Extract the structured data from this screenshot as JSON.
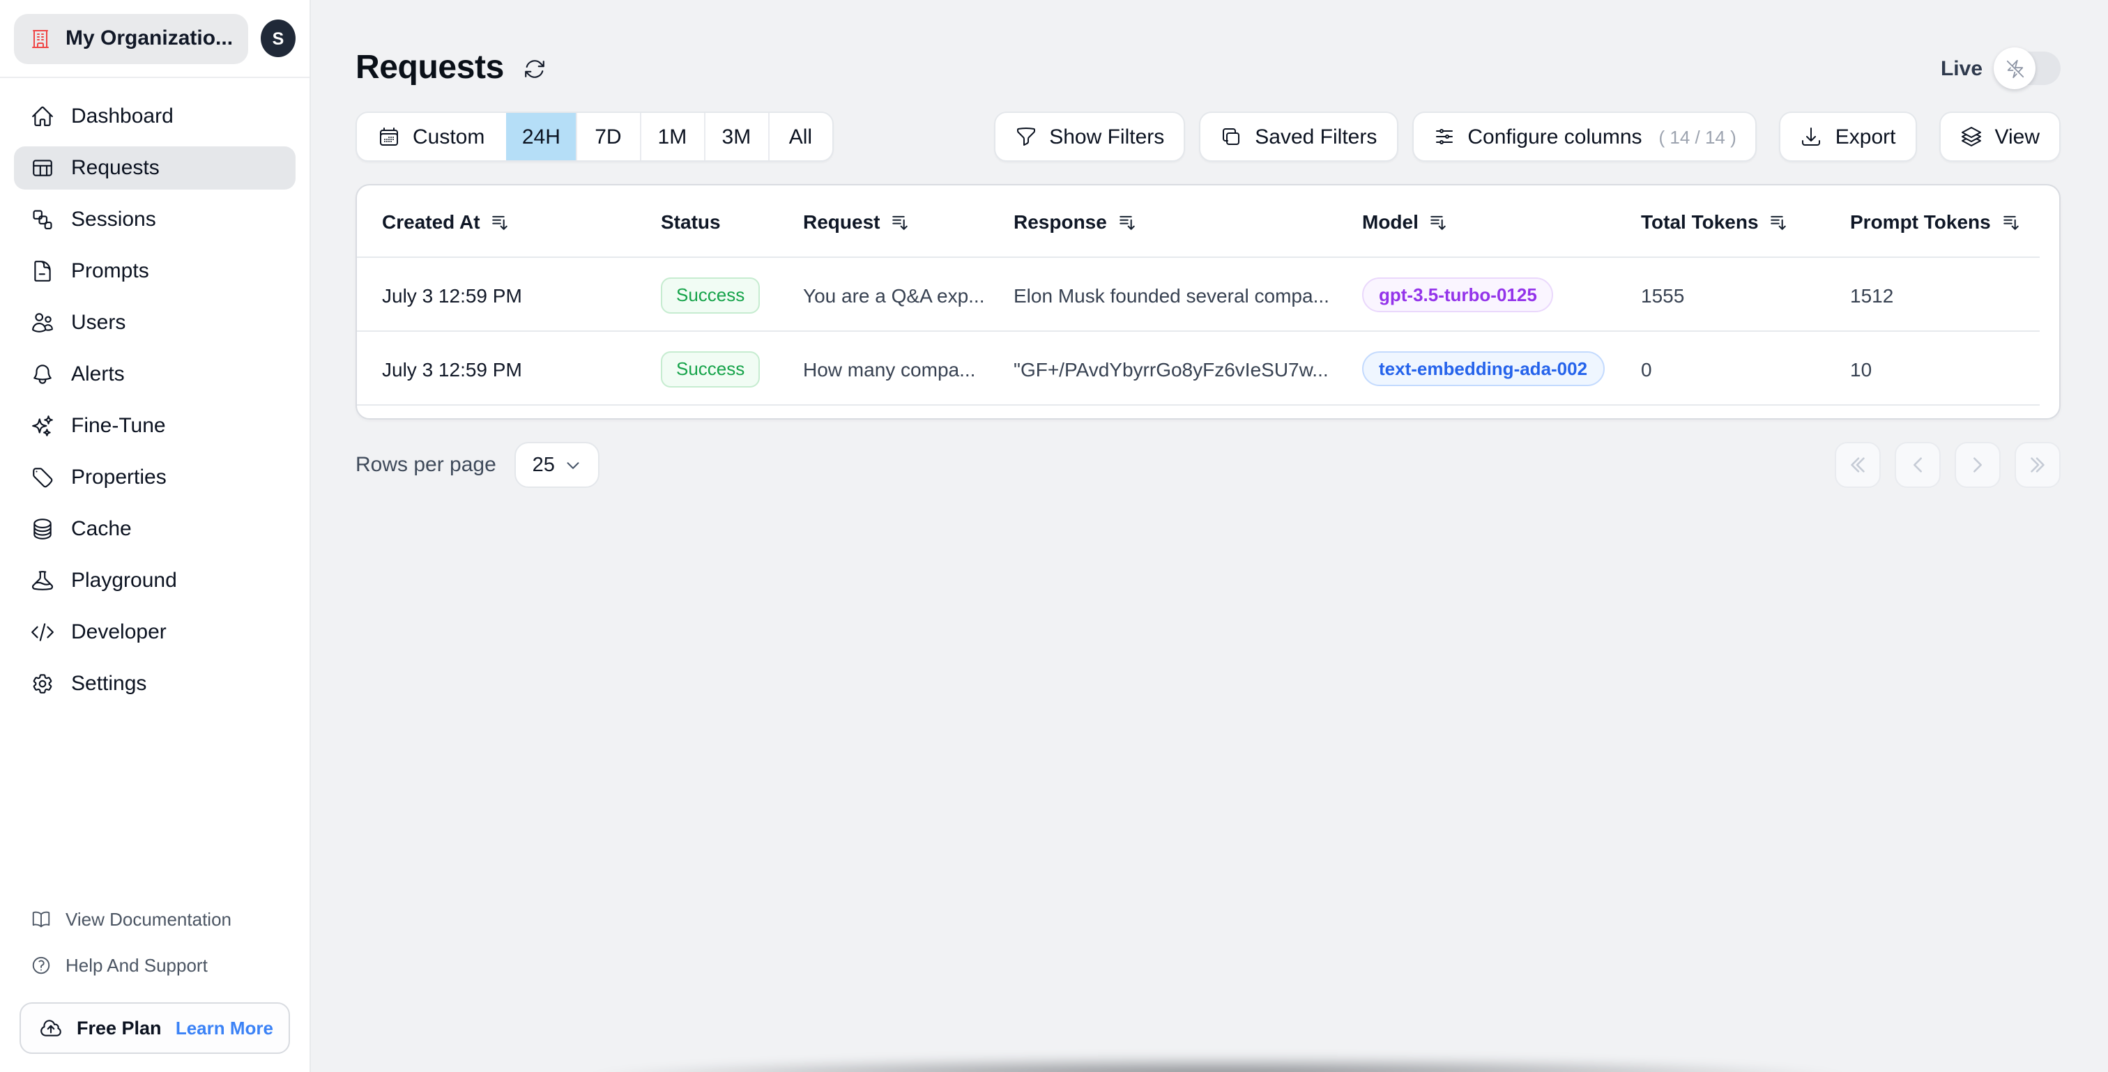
{
  "topbar": {
    "org_name": "My Organizatio...",
    "avatar_initial": "S"
  },
  "sidebar": {
    "items": [
      {
        "label": "Dashboard"
      },
      {
        "label": "Requests",
        "active": true
      },
      {
        "label": "Sessions"
      },
      {
        "label": "Prompts"
      },
      {
        "label": "Users"
      },
      {
        "label": "Alerts"
      },
      {
        "label": "Fine-Tune"
      },
      {
        "label": "Properties"
      },
      {
        "label": "Cache"
      },
      {
        "label": "Playground"
      },
      {
        "label": "Developer"
      },
      {
        "label": "Settings"
      }
    ],
    "footer": {
      "docs": "View Documentation",
      "help": "Help And Support",
      "plan": "Free Plan",
      "plan_link": "Learn More"
    }
  },
  "header": {
    "title": "Requests",
    "live_label": "Live"
  },
  "toolbar": {
    "custom_label": "Custom",
    "ranges": [
      "24H",
      "7D",
      "1M",
      "3M",
      "All"
    ],
    "selected_range": "24H",
    "show_filters": "Show Filters",
    "saved_filters": "Saved Filters",
    "configure_columns": "Configure columns",
    "configure_count": "( 14 / 14 )",
    "export_label": "Export",
    "view_label": "View"
  },
  "table": {
    "columns": [
      "Created At",
      "Status",
      "Request",
      "Response",
      "Model",
      "Total Tokens",
      "Prompt Tokens"
    ],
    "rows": [
      {
        "created_at": "July 3 12:59 PM",
        "status": "Success",
        "request": "You are a Q&A exp...",
        "response": "Elon Musk founded several compa...",
        "model": "gpt-3.5-turbo-0125",
        "total_tokens": "1555",
        "prompt_tokens": "1512"
      },
      {
        "created_at": "July 3 12:59 PM",
        "status": "Success",
        "request": "How many compa...",
        "response": "\"GF+/PAvdYbyrrGo8yFz6vIeSU7w...",
        "model": "text-embedding-ada-002",
        "total_tokens": "0",
        "prompt_tokens": "10"
      }
    ]
  },
  "pagination": {
    "rows_per_page_label": "Rows per page",
    "page_size": "25"
  },
  "colors": {
    "selected_range_bg": "#b5def7",
    "success_text": "#16a34a",
    "model_purple": "#9333ea",
    "model_blue": "#2563eb",
    "org_icon_red": "#ef4444",
    "link_blue": "#3b82f6",
    "main_bg": "#f1f2f4",
    "sidebar_bg": "#ffffff"
  }
}
